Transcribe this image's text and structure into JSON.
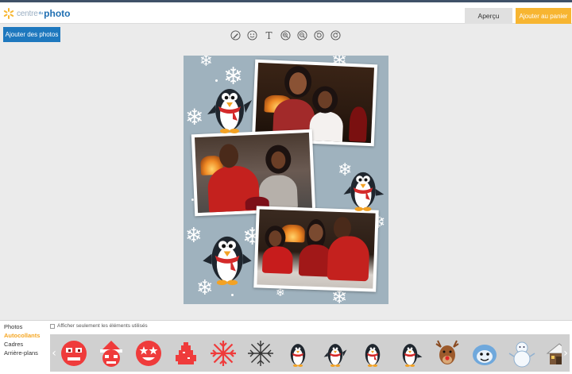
{
  "header": {
    "logo_part1": "centre",
    "logo_part2": "du",
    "logo_part3": "photo",
    "preview_button": "Aperçu",
    "cart_button": "Ajouter au panier"
  },
  "toolbar": {
    "add_photos": "Ajouter des photos",
    "tools": [
      "pencil-icon",
      "smiley-icon",
      "text-icon",
      "zoom-in-icon",
      "zoom-out-icon",
      "rotate-left-icon",
      "rotate-right-icon"
    ],
    "text_tool_glyph": "T"
  },
  "panel": {
    "categories": [
      "Photos",
      "Autocollants",
      "Cadres",
      "Arrière-plans"
    ],
    "active_category": "Autocollants",
    "filter_label": "Afficher seulement les éléments utilisés",
    "stickers": [
      "pixel-face-sticker",
      "pixel-santa-sticker",
      "pixel-star-eyes-sticker",
      "pixel-tree-sticker",
      "red-snowflake-sticker",
      "black-snowflake-sticker",
      "penguin-sticker-1",
      "penguin-sticker-2",
      "penguin-sticker-3",
      "penguin-sticker-4",
      "reindeer-sticker",
      "yeti-sticker",
      "snowman-sticker",
      "cabin-sticker"
    ]
  },
  "colors": {
    "accent_blue": "#1e78be",
    "cart_orange": "#f7b531",
    "canvas_bg": "#9fb2be",
    "active_category": "#f5a623"
  }
}
